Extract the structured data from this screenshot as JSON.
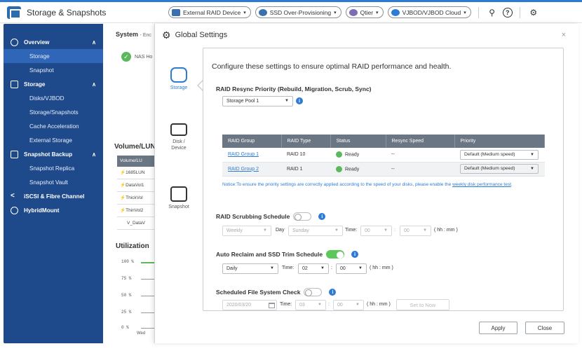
{
  "app": {
    "title": "Storage & Snapshots"
  },
  "toolbar": {
    "buttons": [
      {
        "label": "External RAID Device",
        "color": "#3a6fb0"
      },
      {
        "label": "SSD Over-Provisioning",
        "color": "#3a6fb0"
      },
      {
        "label": "Qtier",
        "color": "#7d6bb3"
      },
      {
        "label": "VJBOD/VJBOD Cloud",
        "color": "#2e7bd6"
      }
    ],
    "icons": [
      "search-sliders-icon",
      "help-icon",
      "settings-gear-icon"
    ]
  },
  "sidebar": {
    "items": [
      {
        "label": "Overview",
        "level": "top",
        "icon": "clock-icon"
      },
      {
        "label": "Storage",
        "level": "sub",
        "active": true
      },
      {
        "label": "Snapshot",
        "level": "sub"
      },
      {
        "label": "Storage",
        "level": "top",
        "icon": "database-icon"
      },
      {
        "label": "Disks/VJBOD",
        "level": "sub"
      },
      {
        "label": "Storage/Snapshots",
        "level": "sub"
      },
      {
        "label": "Cache Acceleration",
        "level": "sub"
      },
      {
        "label": "External Storage",
        "level": "sub"
      },
      {
        "label": "Snapshot Backup",
        "level": "top",
        "icon": "backup-icon"
      },
      {
        "label": "Snapshot Replica",
        "level": "sub"
      },
      {
        "label": "Snapshot Vault",
        "level": "sub"
      },
      {
        "label": "iSCSI & Fibre Channel",
        "level": "top",
        "icon": "share-icon"
      },
      {
        "label": "HybridMount",
        "level": "top",
        "icon": "link-icon"
      }
    ]
  },
  "background": {
    "system_title": "System",
    "system_sub": "- Enc",
    "nas_status": "NAS Ho",
    "volume_title": "Volume/LUN",
    "volume_header": "Volume/LU",
    "volume_rows": [
      "1685LUN",
      "DataVol1",
      "ThickVol",
      "ThinVol2",
      "V_DataV"
    ],
    "utilization_title": "Utilization",
    "util_axis": [
      "100 %",
      "75 %",
      "50 %",
      "25 %",
      "0 %"
    ],
    "weekday": "Wed"
  },
  "modal": {
    "title": "Global Settings",
    "close": "×",
    "nav": [
      {
        "label": "Storage",
        "active": true
      },
      {
        "label": "Disk / Device",
        "active": false
      },
      {
        "label": "Snapshot",
        "active": false
      }
    ],
    "intro": "Configure these settings to ensure optimal RAID performance and health.",
    "resync": {
      "label": "RAID Resync Priority (Rebuild, Migration, Scrub, Sync)",
      "pool_select": "Storage Pool 1",
      "columns": [
        "RAID Group",
        "RAID Type",
        "Status",
        "Resync Speed",
        "Priority"
      ],
      "rows": [
        {
          "group": "RAID Group 1",
          "type": "RAID 10",
          "status": "Ready",
          "speed": "--",
          "priority": "Default (Medium speed)"
        },
        {
          "group": "RAID Group 2",
          "type": "RAID 1",
          "status": "Ready",
          "speed": "--",
          "priority": "Default (Medium speed)"
        }
      ],
      "notice": "Notice:To ensure the priority settings are correctly applied according to the speed of your disks, please enable the ",
      "notice_link": "weekly disk performance test",
      "notice_end": "."
    },
    "scrubbing": {
      "label": "RAID Scrubbing Schedule",
      "enabled": false,
      "frequency": "Weekly",
      "day_label": "Day",
      "day": "Sunday",
      "time_label": "Time:",
      "hour": "00",
      "minute": "00",
      "format": "( hh : mm )"
    },
    "trim": {
      "label": "Auto Reclaim and SSD Trim Schedule",
      "enabled": true,
      "frequency": "Daily",
      "time_label": "Time:",
      "hour": "02",
      "minute": "00",
      "format": "( hh : mm )"
    },
    "fscheck": {
      "label": "Scheduled File System Check",
      "enabled": false,
      "date": "2020/03/20",
      "time_label": "Time:",
      "hour": "03",
      "minute": "00",
      "format": "( hh : mm )",
      "set_now": "Set to Now"
    },
    "apply": "Apply",
    "close_btn": "Close"
  }
}
